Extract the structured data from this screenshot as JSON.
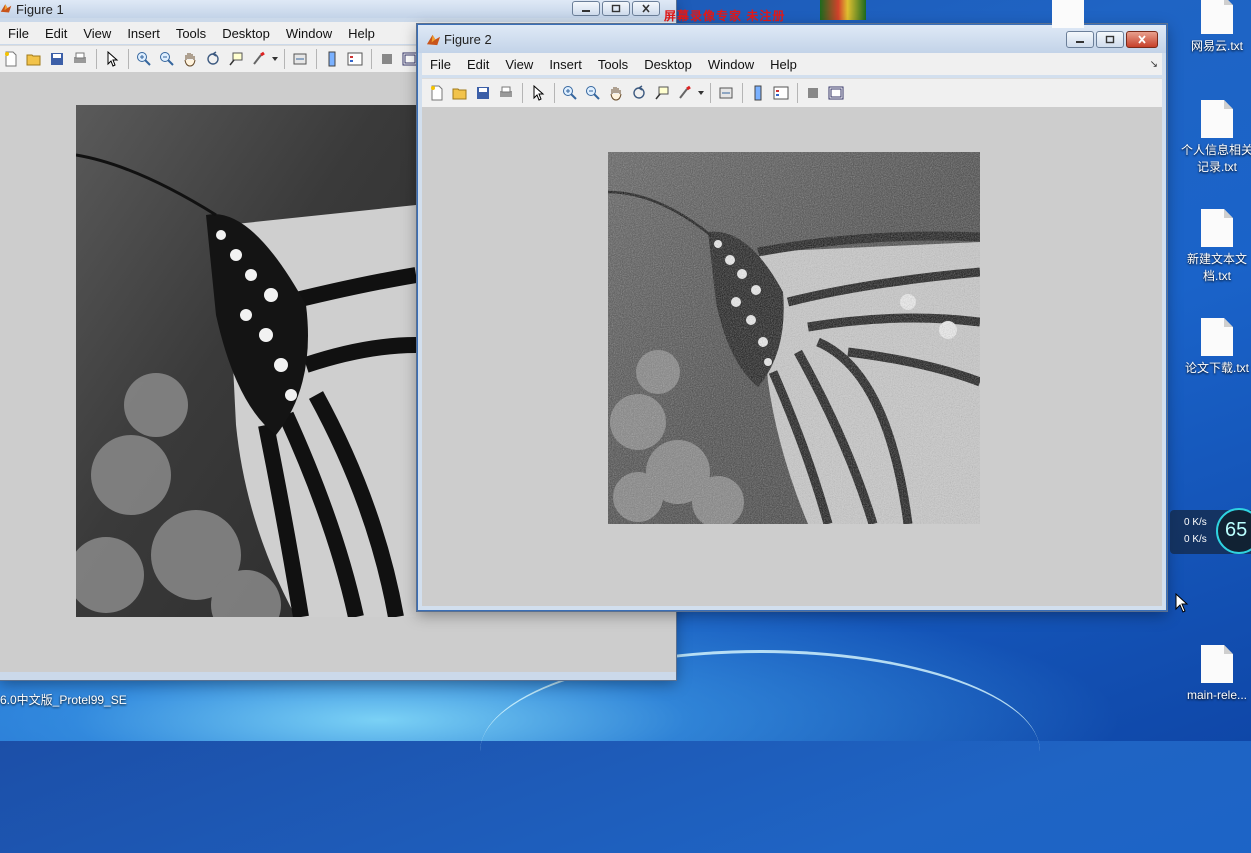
{
  "figure1": {
    "title": "Figure 1",
    "menu": [
      "File",
      "Edit",
      "View",
      "Insert",
      "Tools",
      "Desktop",
      "Window",
      "Help"
    ]
  },
  "figure2": {
    "title": "Figure 2",
    "menu": [
      "File",
      "Edit",
      "View",
      "Insert",
      "Tools",
      "Desktop",
      "Window",
      "Help"
    ]
  },
  "overlay": {
    "recorder_watermark": "屏幕录像专家 未注册"
  },
  "taskbar_text": "6.0中文版_Protel99_SE",
  "desktop_icons": [
    {
      "label": "网易云.txt"
    },
    {
      "label": "个人信息相关记录.txt"
    },
    {
      "label": "新建文本文档.txt"
    },
    {
      "label": "论文下载.txt"
    },
    {
      "label": "main-rele..."
    }
  ],
  "net_widget": {
    "up": "0 K/s",
    "down": "0 K/s",
    "percent": "65"
  }
}
